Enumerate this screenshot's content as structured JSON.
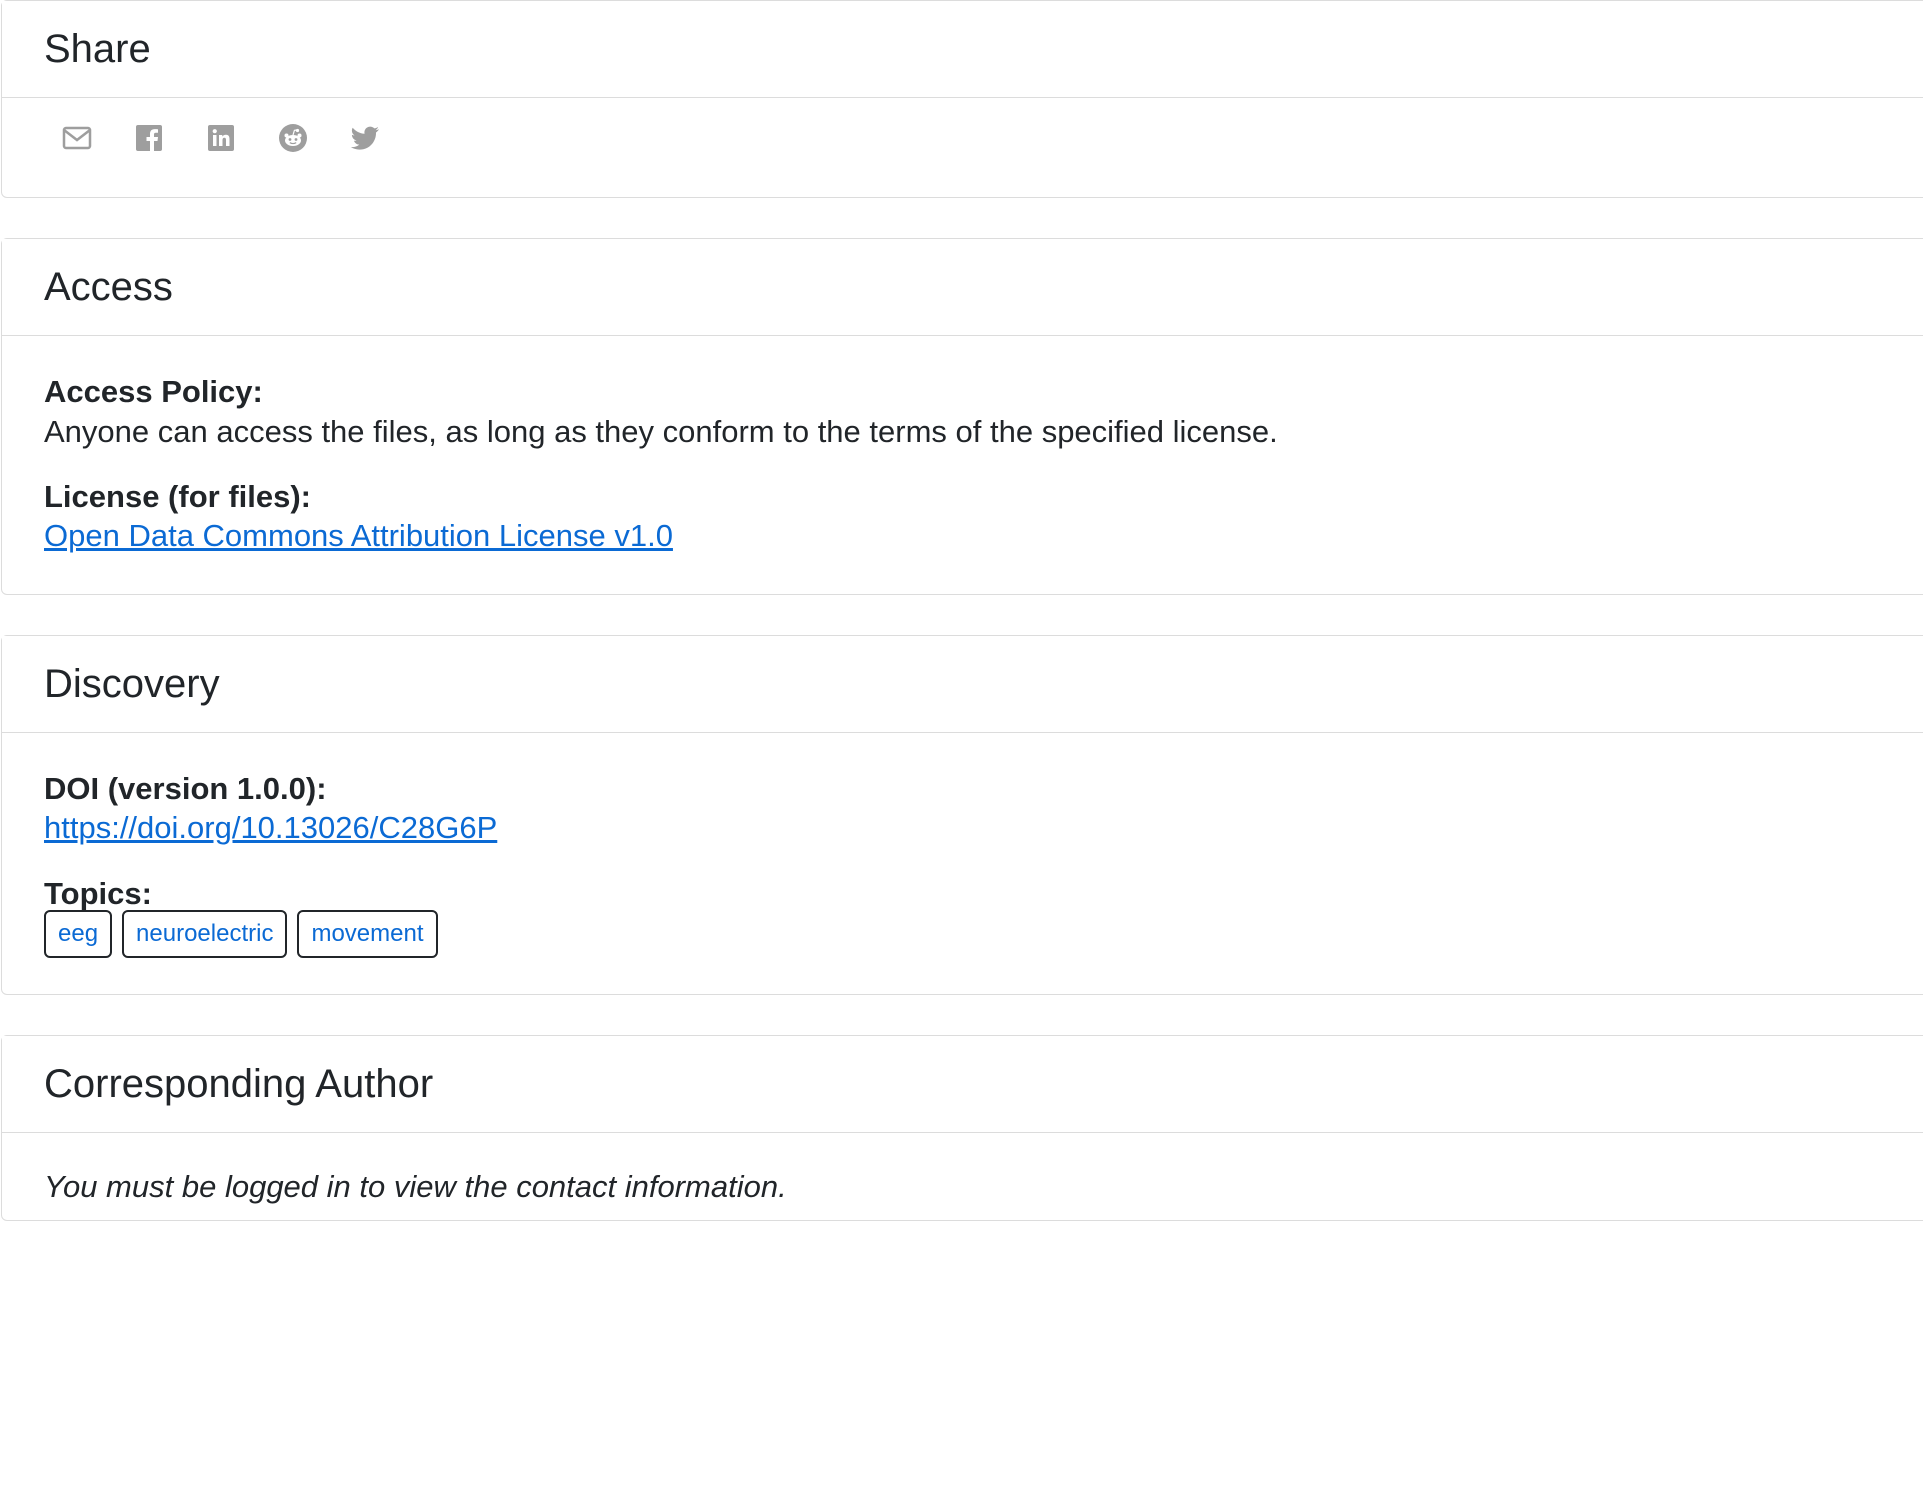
{
  "share": {
    "title": "Share",
    "icons": [
      "email-icon",
      "facebook-icon",
      "linkedin-icon",
      "reddit-icon",
      "twitter-icon"
    ]
  },
  "access": {
    "title": "Access",
    "policy_label": "Access Policy:",
    "policy_text": "Anyone can access the files, as long as they conform to the terms of the specified license.",
    "license_label": "License (for files):",
    "license_link": "Open Data Commons Attribution License v1.0"
  },
  "discovery": {
    "title": "Discovery",
    "doi_label": "DOI (version 1.0.0):",
    "doi_link": "https://doi.org/10.13026/C28G6P",
    "topics_label": "Topics:",
    "topics": [
      "eeg",
      "neuroelectric",
      "movement"
    ]
  },
  "author": {
    "title": "Corresponding Author",
    "note": "You must be logged in to view the contact information."
  },
  "colors": {
    "link": "#0b6ad4",
    "icon": "#9e9e9e",
    "border": "#dcdcdc"
  }
}
